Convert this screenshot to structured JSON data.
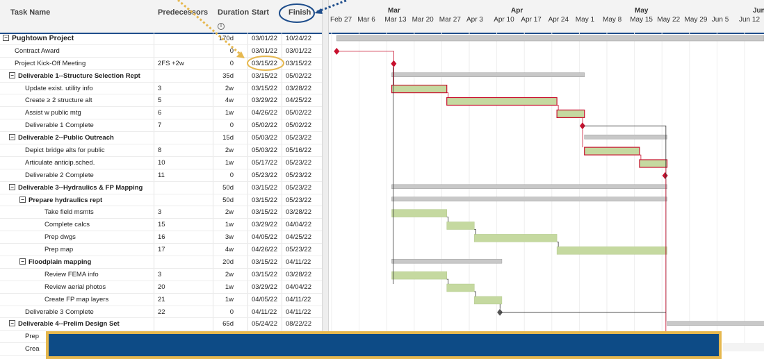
{
  "columns": {
    "task_name": "Task Name",
    "predecessors": "Predecessors",
    "duration": "Duration",
    "start": "Start",
    "finish": "Finish"
  },
  "timeline": {
    "months": [
      "Mar",
      "Apr",
      "May",
      "Jun"
    ],
    "weeks": [
      "Feb 27",
      "Mar 6",
      "Mar 13",
      "Mar 20",
      "Mar 27",
      "Apr 3",
      "Apr 10",
      "Apr 17",
      "Apr 24",
      "May 1",
      "May 8",
      "May 15",
      "May 22",
      "May 29",
      "Jun 5",
      "Jun 12"
    ]
  },
  "tasks": [
    {
      "name": "Pughtown Project",
      "pred": "",
      "dur": "170d",
      "start": "03/01/22",
      "finish": "10/24/22",
      "level": 0,
      "type": "project"
    },
    {
      "name": "Contract Award",
      "pred": "",
      "dur": "0",
      "start": "03/01/22",
      "finish": "03/01/22",
      "level": 1,
      "type": "task"
    },
    {
      "name": "Project Kick-Off Meeting",
      "pred": "2FS +2w",
      "dur": "0",
      "start": "03/15/22",
      "finish": "03/15/22",
      "level": 1,
      "type": "task"
    },
    {
      "name": "Deliverable 1--Structure Selection Rept",
      "pred": "",
      "dur": "35d",
      "start": "03/15/22",
      "finish": "05/02/22",
      "level": 1,
      "type": "summary"
    },
    {
      "name": "Update exist. utility info",
      "pred": "3",
      "dur": "2w",
      "start": "03/15/22",
      "finish": "03/28/22",
      "level": 2,
      "type": "task"
    },
    {
      "name": "Create ≥ 2 structure alt",
      "pred": "5",
      "dur": "4w",
      "start": "03/29/22",
      "finish": "04/25/22",
      "level": 2,
      "type": "task"
    },
    {
      "name": "Assist w public mtg",
      "pred": "6",
      "dur": "1w",
      "start": "04/26/22",
      "finish": "05/02/22",
      "level": 2,
      "type": "task"
    },
    {
      "name": "Deliverable 1 Complete",
      "pred": "7",
      "dur": "0",
      "start": "05/02/22",
      "finish": "05/02/22",
      "level": 2,
      "type": "task"
    },
    {
      "name": "Deliverable 2--Public Outreach",
      "pred": "",
      "dur": "15d",
      "start": "05/03/22",
      "finish": "05/23/22",
      "level": 1,
      "type": "summary"
    },
    {
      "name": "Depict bridge alts for public",
      "pred": "8",
      "dur": "2w",
      "start": "05/03/22",
      "finish": "05/16/22",
      "level": 2,
      "type": "task"
    },
    {
      "name": "Articulate anticip.sched.",
      "pred": "10",
      "dur": "1w",
      "start": "05/17/22",
      "finish": "05/23/22",
      "level": 2,
      "type": "task"
    },
    {
      "name": "Deliverable 2 Complete",
      "pred": "11",
      "dur": "0",
      "start": "05/23/22",
      "finish": "05/23/22",
      "level": 2,
      "type": "task"
    },
    {
      "name": "Deliverable 3--Hydraulics & FP Mapping",
      "pred": "",
      "dur": "50d",
      "start": "03/15/22",
      "finish": "05/23/22",
      "level": 1,
      "type": "summary"
    },
    {
      "name": "Prepare hydraulics rept",
      "pred": "",
      "dur": "50d",
      "start": "03/15/22",
      "finish": "05/23/22",
      "level": 2,
      "type": "summary"
    },
    {
      "name": "Take field msmts",
      "pred": "3",
      "dur": "2w",
      "start": "03/15/22",
      "finish": "03/28/22",
      "level": 3,
      "type": "task"
    },
    {
      "name": "Complete calcs",
      "pred": "15",
      "dur": "1w",
      "start": "03/29/22",
      "finish": "04/04/22",
      "level": 3,
      "type": "task"
    },
    {
      "name": "Prep dwgs",
      "pred": "16",
      "dur": "3w",
      "start": "04/05/22",
      "finish": "04/25/22",
      "level": 3,
      "type": "task"
    },
    {
      "name": "Prep map",
      "pred": "17",
      "dur": "4w",
      "start": "04/26/22",
      "finish": "05/23/22",
      "level": 3,
      "type": "task"
    },
    {
      "name": "Floodplain mapping",
      "pred": "",
      "dur": "20d",
      "start": "03/15/22",
      "finish": "04/11/22",
      "level": 2,
      "type": "summary"
    },
    {
      "name": "Review FEMA info",
      "pred": "3",
      "dur": "2w",
      "start": "03/15/22",
      "finish": "03/28/22",
      "level": 3,
      "type": "task"
    },
    {
      "name": "Review aerial photos",
      "pred": "20",
      "dur": "1w",
      "start": "03/29/22",
      "finish": "04/04/22",
      "level": 3,
      "type": "task"
    },
    {
      "name": "Create FP map layers",
      "pred": "21",
      "dur": "1w",
      "start": "04/05/22",
      "finish": "04/11/22",
      "level": 3,
      "type": "task"
    },
    {
      "name": "Deliverable 3 Complete",
      "pred": "22",
      "dur": "0",
      "start": "04/11/22",
      "finish": "04/11/22",
      "level": 2,
      "type": "task"
    },
    {
      "name": "Deliverable 4--Prelim Design Set",
      "pred": "",
      "dur": "65d",
      "start": "05/24/22",
      "finish": "08/22/22",
      "level": 1,
      "type": "summary"
    },
    {
      "name": "Prep",
      "pred": "",
      "dur": "",
      "start": "",
      "finish": "",
      "level": 2,
      "type": "task"
    },
    {
      "name": "Crea",
      "pred": "",
      "dur": "",
      "start": "",
      "finish": "",
      "level": 2,
      "type": "task"
    }
  ],
  "colors": {
    "accent_blue": "#1f4e8c",
    "callout_orange": "#e6b84f",
    "overlay_blue": "#0d4b86",
    "critical_red": "#c8102e",
    "task_green": "#c5d9a0",
    "summary_gray": "#c8c8c8"
  }
}
